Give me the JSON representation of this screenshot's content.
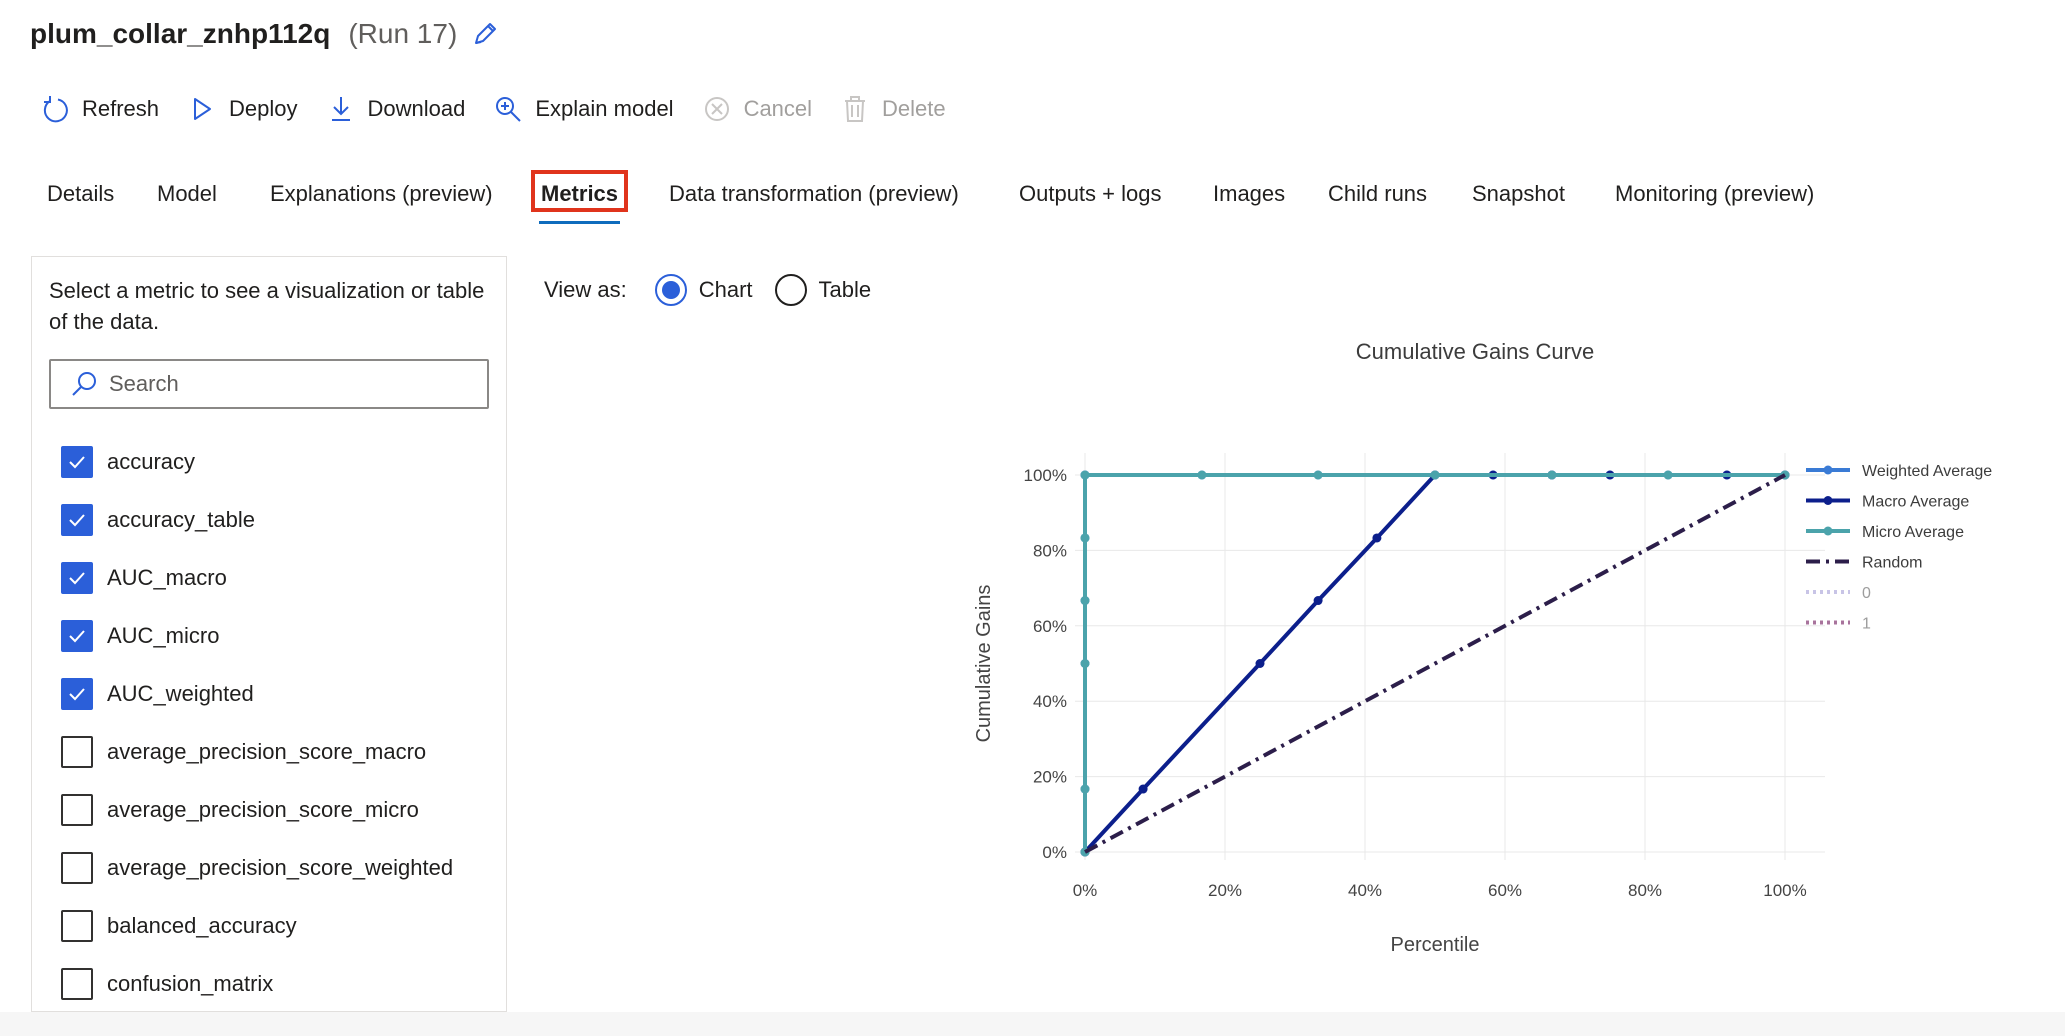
{
  "run": {
    "name": "plum_collar_znhp112q",
    "number": "(Run 17)"
  },
  "toolbar": {
    "refresh": "Refresh",
    "deploy": "Deploy",
    "download": "Download",
    "explain": "Explain model",
    "cancel": "Cancel",
    "delete": "Delete"
  },
  "tabs": [
    "Details",
    "Model",
    "Explanations (preview)",
    "Metrics",
    "Data transformation (preview)",
    "Outputs + logs",
    "Images",
    "Child runs",
    "Snapshot",
    "Monitoring (preview)"
  ],
  "active_tab": "Metrics",
  "metrics_panel": {
    "hint": "Select a metric to see a visualization or table of the data.",
    "search_placeholder": "Search",
    "items": [
      {
        "label": "accuracy",
        "checked": true
      },
      {
        "label": "accuracy_table",
        "checked": true
      },
      {
        "label": "AUC_macro",
        "checked": true
      },
      {
        "label": "AUC_micro",
        "checked": true
      },
      {
        "label": "AUC_weighted",
        "checked": true
      },
      {
        "label": "average_precision_score_macro",
        "checked": false
      },
      {
        "label": "average_precision_score_micro",
        "checked": false
      },
      {
        "label": "average_precision_score_weighted",
        "checked": false
      },
      {
        "label": "balanced_accuracy",
        "checked": false
      },
      {
        "label": "confusion_matrix",
        "checked": false
      }
    ]
  },
  "view_as": {
    "label": "View as:",
    "chart": "Chart",
    "table": "Table",
    "selected": "Chart"
  },
  "colors": {
    "accent": "#2b5fd9",
    "highlight_box": "#e0341c",
    "weighted": "#3a7bd5",
    "macro": "#0c1f8c",
    "micro": "#4ba3ab",
    "random": "#2c1e4a",
    "class0": "#c8c4e6",
    "class1": "#a8739c"
  },
  "chart_data": {
    "type": "line",
    "title": "Cumulative Gains Curve",
    "xlabel": "Percentile",
    "ylabel": "Cumulative Gains",
    "xlim": [
      0,
      100
    ],
    "ylim": [
      0,
      100
    ],
    "x_ticks": [
      "0%",
      "20%",
      "40%",
      "60%",
      "80%",
      "100%"
    ],
    "y_ticks": [
      "0%",
      "20%",
      "40%",
      "60%",
      "80%",
      "100%"
    ],
    "grid": true,
    "legend_position": "right",
    "series": [
      {
        "name": "Weighted Average",
        "color": "#3a7bd5",
        "style": "solid",
        "markers": true,
        "x": [
          0,
          0,
          0,
          0,
          0,
          0,
          0,
          16.7,
          33.3,
          50,
          58.3,
          66.7,
          75,
          83.3,
          91.7,
          100
        ],
        "y": [
          0,
          16.7,
          50,
          66.7,
          83.3,
          100,
          100,
          100,
          100,
          100,
          100,
          100,
          100,
          100,
          100,
          100
        ]
      },
      {
        "name": "Macro Average",
        "color": "#0c1f8c",
        "style": "solid",
        "markers": true,
        "x": [
          0,
          8.3,
          25,
          33.3,
          41.7,
          50,
          58.3,
          66.7,
          75,
          91.7,
          100
        ],
        "y": [
          0,
          16.7,
          50,
          66.7,
          83.3,
          100,
          100,
          100,
          100,
          100,
          100
        ]
      },
      {
        "name": "Micro Average",
        "color": "#4ba3ab",
        "style": "solid",
        "markers": true,
        "x": [
          0,
          0,
          0,
          0,
          0,
          0,
          16.7,
          33.3,
          50,
          66.7,
          83.3,
          100
        ],
        "y": [
          0,
          16.7,
          50,
          66.7,
          83.3,
          100,
          100,
          100,
          100,
          100,
          100,
          100
        ]
      },
      {
        "name": "Random",
        "color": "#2c1e4a",
        "style": "dashdot",
        "markers": false,
        "x": [
          0,
          100
        ],
        "y": [
          0,
          100
        ]
      },
      {
        "name": "0",
        "color": "#c8c4e6",
        "style": "dotted",
        "markers": false,
        "hidden": true,
        "x": [],
        "y": []
      },
      {
        "name": "1",
        "color": "#a8739c",
        "style": "dotted",
        "markers": false,
        "hidden": true,
        "x": [],
        "y": []
      }
    ]
  }
}
